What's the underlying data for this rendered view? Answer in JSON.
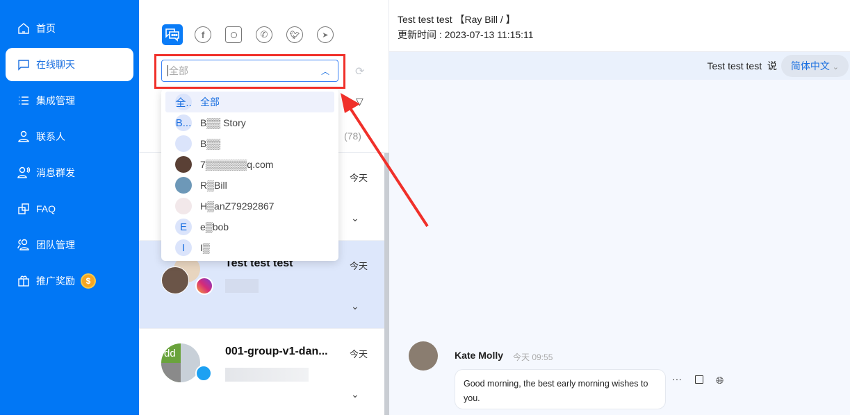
{
  "sidebar": {
    "items": [
      {
        "label": "首页",
        "icon": "home-icon"
      },
      {
        "label": "在线聊天",
        "icon": "chat-icon",
        "active": true
      },
      {
        "label": "集成管理",
        "icon": "list-icon"
      },
      {
        "label": "联系人",
        "icon": "user-icon"
      },
      {
        "label": "消息群发",
        "icon": "broadcast-icon"
      },
      {
        "label": "FAQ",
        "icon": "faq-icon"
      },
      {
        "label": "团队管理",
        "icon": "team-icon"
      },
      {
        "label": "推广奖励",
        "icon": "gift-icon",
        "badge": "$"
      }
    ]
  },
  "channels": [
    "all-chat",
    "facebook",
    "instagram",
    "whatsapp",
    "twitter",
    "telegram"
  ],
  "select": {
    "placeholder": "全部"
  },
  "dropdown": [
    {
      "avatar": "全..",
      "label": "全部",
      "selected": true
    },
    {
      "avatar": "B...",
      "label": "B▒▒ Story"
    },
    {
      "avatar": "",
      "label": "B▒▒"
    },
    {
      "avatar": "",
      "label": "7▒▒▒▒▒▒q.com"
    },
    {
      "avatar": "",
      "label": "R▒Bill"
    },
    {
      "avatar": "",
      "label": "H▒anZ79292867"
    },
    {
      "avatar": "E",
      "label": "e▒bob"
    },
    {
      "avatar": "I",
      "label": "I▒"
    }
  ],
  "list": {
    "count": "(78)",
    "conversations": [
      {
        "name": "",
        "time": "今天"
      },
      {
        "name": "Test test test",
        "time": "今天",
        "channel": "instagram",
        "selected": true
      },
      {
        "name": "001-group-v1-dan...",
        "time": "今天",
        "channel": "twitter",
        "group_initials": "dd"
      }
    ]
  },
  "chat": {
    "title": "Test test test 【Ray Bill / 】",
    "updated": "更新时间 : 2023-07-13 11:15:11",
    "speaker": "Test test test",
    "says": "说",
    "language": "简体中文",
    "message": {
      "sender": "Kate Molly",
      "time": "今天 09:55",
      "text": "Good morning, the best early morning wishes to you."
    }
  },
  "colors": {
    "sidebar": "#0177f5",
    "accent": "#1a6fe0",
    "highlight": "#f0302a"
  }
}
